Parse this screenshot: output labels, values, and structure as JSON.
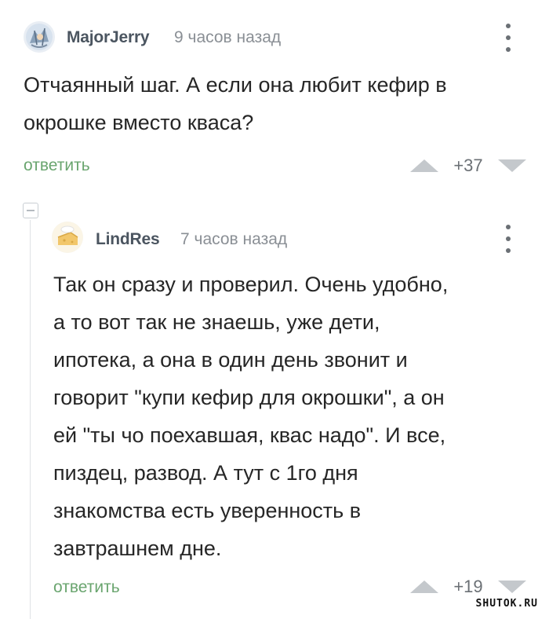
{
  "comments": [
    {
      "author": "MajorJerry",
      "time": "9 часов назад",
      "text": "Отчаянный шаг. А если она любит кефир в\nокрошке вместо кваса?",
      "reply_label": "ответить",
      "score": "+37"
    },
    {
      "author": "LindRes",
      "time": "7 часов назад",
      "text": "Так он сразу и проверил. Очень удобно,\nа то вот так не знаешь, уже дети,\nипотека, а она в один день звонит и\nговорит \"купи кефир для окрошки\", а он\nей \"ты чо поехавшая, квас надо\". И все,\nпиздец, развод. А тут с 1го дня\nзнакомства есть уверенность в\nзавтрашнем дне.",
      "reply_label": "ответить",
      "score": "+19"
    }
  ],
  "watermark": "SHUTOK.RU",
  "colors": {
    "reply_link": "#6aa56f",
    "author": "#4b5560",
    "meta": "#8a8f95",
    "vote_arrow": "#c4c8cc"
  },
  "icons": {
    "menu": "vertical-ellipsis-icon",
    "upvote": "triangle-up-icon",
    "downvote": "triangle-down-icon",
    "collapse": "collapse-minus-icon"
  }
}
